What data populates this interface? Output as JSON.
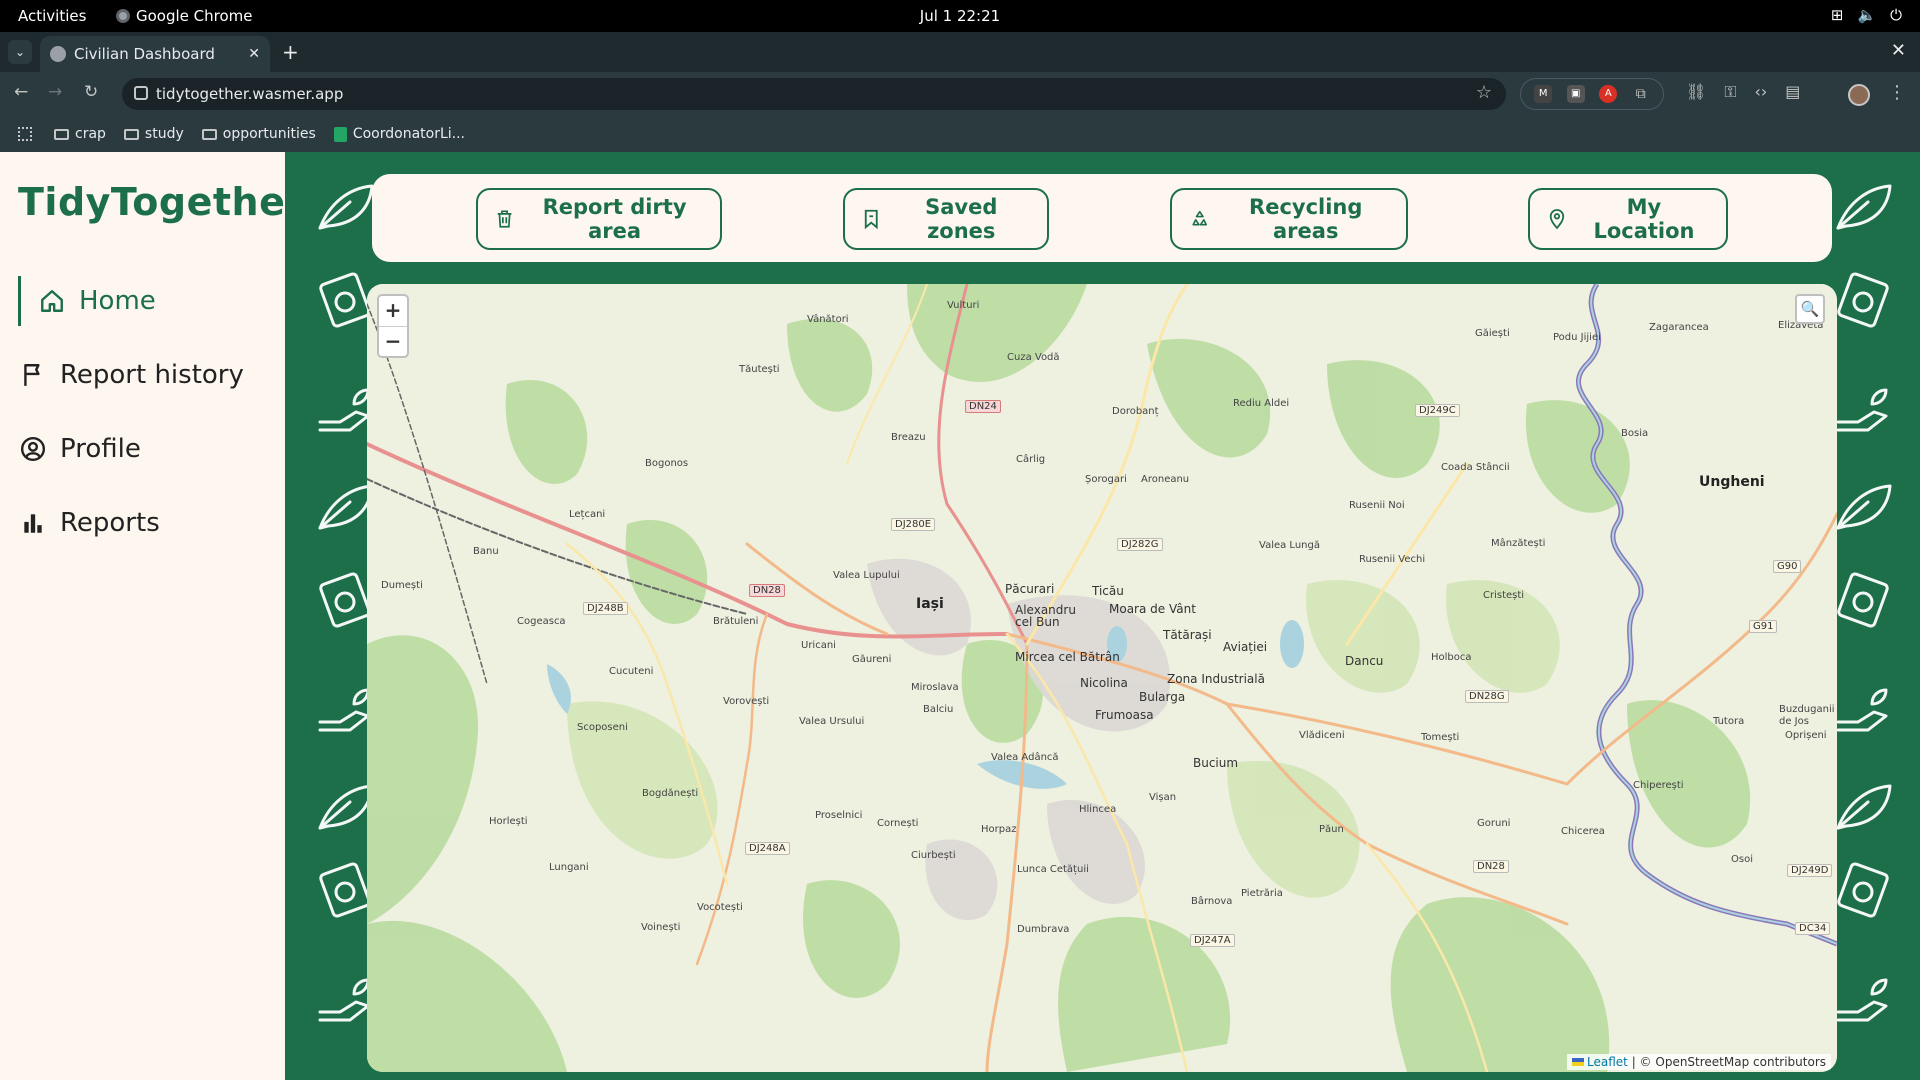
{
  "system_bar": {
    "activities": "Activities",
    "app_name": "Google Chrome",
    "clock": "Jul 1  22:21"
  },
  "browser": {
    "tab_title": "Civilian Dashboard",
    "url": "tidytogether.wasmer.app",
    "bookmarks": [
      "crap",
      "study",
      "opportunities",
      "CoordonatorLi..."
    ]
  },
  "app": {
    "logo": "TidyTogether",
    "nav": [
      {
        "label": "Home",
        "icon": "home-icon",
        "active": true
      },
      {
        "label": "Report history",
        "icon": "flag-icon",
        "active": false
      },
      {
        "label": "Profile",
        "icon": "user-circle-icon",
        "active": false
      },
      {
        "label": "Reports",
        "icon": "bar-chart-icon",
        "active": false
      }
    ],
    "actions": [
      {
        "label": "Report dirty area",
        "icon": "trash-icon"
      },
      {
        "label": "Saved zones",
        "icon": "bookmark-icon"
      },
      {
        "label": "Recycling areas",
        "icon": "recycle-icon"
      },
      {
        "label": "My Location",
        "icon": "location-pin-icon"
      }
    ],
    "colors": {
      "brand": "#1d6f4a",
      "panel": "#fdf7ef"
    }
  },
  "map": {
    "zoom_in": "+",
    "zoom_out": "−",
    "attribution_leaflet": "Leaflet",
    "attribution_rest": "| © OpenStreetMap contributors",
    "places_major": [
      "Iași",
      "Ungheni"
    ],
    "places": [
      "Vânători",
      "Vulturi",
      "Cuza Vodă",
      "Tăutești",
      "Dorobanț",
      "Rediu Aldei",
      "Breazu",
      "Cârlig",
      "Bogonos",
      "Șorogari",
      "Aroneanu",
      "Lețcani",
      "Banu",
      "Dumești",
      "Valea Lupului",
      "Păcurari",
      "Ticău",
      "Moara de Vânt",
      "Alexandru cel Bun",
      "Tătărași",
      "Cogeasca",
      "Brătuleni",
      "Uricani",
      "Găureni",
      "Cucuteni",
      "Mircea cel Bătrân",
      "Aviației",
      "Dancu",
      "Holboca",
      "Nicolina",
      "Zona Industrială",
      "Bularga",
      "Frumoasa",
      "Miroslava",
      "Vorovești",
      "Balciu",
      "Scoposeni",
      "Valea Ursului",
      "Vlădiceni",
      "Tomești",
      "Bogdănești",
      "Valea Adâncă",
      "Bucium",
      "Horlești",
      "Proselnici",
      "Cornești",
      "Hlincea",
      "Vișan",
      "Horpaz",
      "Lungani",
      "Ciurbești",
      "Lunca Cetățuii",
      "Păun",
      "Vocotești",
      "Voinești",
      "Dumbrava",
      "Bârnova",
      "Pietrăria",
      "Goruni",
      "Chicerea",
      "Osoi",
      "Chiperești",
      "Tutora",
      "Oprișeni",
      "Buzduganii de Jos",
      "Găiești",
      "Podu Jijiei",
      "Zagarancea",
      "Bosia",
      "Coada Stâncii",
      "Rusenii Noi",
      "Valea Lungă",
      "Rusenii Vechi",
      "Mânzătești",
      "Cristești",
      "Elizaveta"
    ],
    "roads": [
      "DN24",
      "DJ249C",
      "DJ280E",
      "DJ282G",
      "DN28",
      "DJ248B",
      "DN28G",
      "G90",
      "G91",
      "DJ248A",
      "DN28",
      "DJ249D",
      "DJ247A",
      "DC34"
    ]
  }
}
